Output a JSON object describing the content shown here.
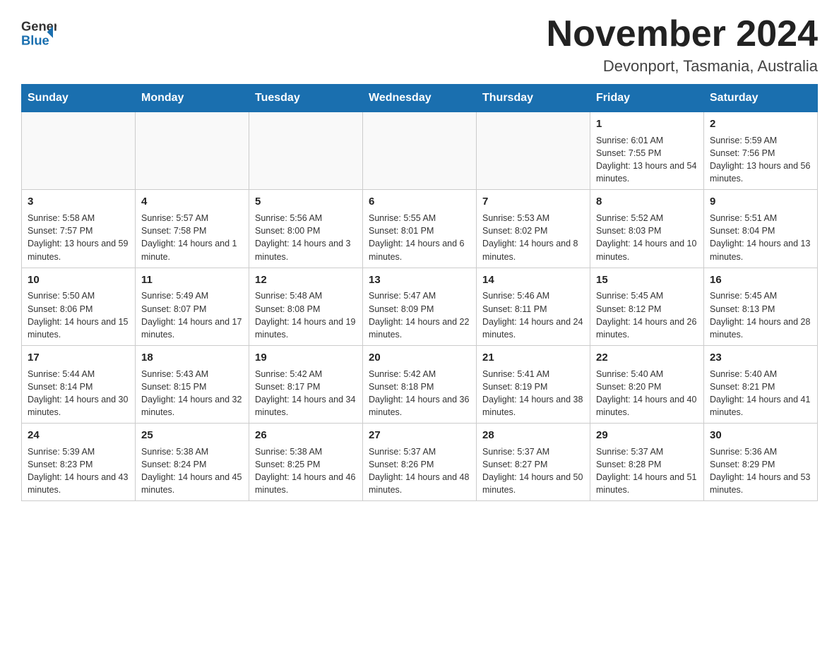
{
  "header": {
    "logo_general": "General",
    "logo_blue": "Blue",
    "month_title": "November 2024",
    "location": "Devonport, Tasmania, Australia"
  },
  "weekdays": [
    "Sunday",
    "Monday",
    "Tuesday",
    "Wednesday",
    "Thursday",
    "Friday",
    "Saturday"
  ],
  "weeks": [
    [
      {
        "day": "",
        "sunrise": "",
        "sunset": "",
        "daylight": ""
      },
      {
        "day": "",
        "sunrise": "",
        "sunset": "",
        "daylight": ""
      },
      {
        "day": "",
        "sunrise": "",
        "sunset": "",
        "daylight": ""
      },
      {
        "day": "",
        "sunrise": "",
        "sunset": "",
        "daylight": ""
      },
      {
        "day": "",
        "sunrise": "",
        "sunset": "",
        "daylight": ""
      },
      {
        "day": "1",
        "sunrise": "Sunrise: 6:01 AM",
        "sunset": "Sunset: 7:55 PM",
        "daylight": "Daylight: 13 hours and 54 minutes."
      },
      {
        "day": "2",
        "sunrise": "Sunrise: 5:59 AM",
        "sunset": "Sunset: 7:56 PM",
        "daylight": "Daylight: 13 hours and 56 minutes."
      }
    ],
    [
      {
        "day": "3",
        "sunrise": "Sunrise: 5:58 AM",
        "sunset": "Sunset: 7:57 PM",
        "daylight": "Daylight: 13 hours and 59 minutes."
      },
      {
        "day": "4",
        "sunrise": "Sunrise: 5:57 AM",
        "sunset": "Sunset: 7:58 PM",
        "daylight": "Daylight: 14 hours and 1 minute."
      },
      {
        "day": "5",
        "sunrise": "Sunrise: 5:56 AM",
        "sunset": "Sunset: 8:00 PM",
        "daylight": "Daylight: 14 hours and 3 minutes."
      },
      {
        "day": "6",
        "sunrise": "Sunrise: 5:55 AM",
        "sunset": "Sunset: 8:01 PM",
        "daylight": "Daylight: 14 hours and 6 minutes."
      },
      {
        "day": "7",
        "sunrise": "Sunrise: 5:53 AM",
        "sunset": "Sunset: 8:02 PM",
        "daylight": "Daylight: 14 hours and 8 minutes."
      },
      {
        "day": "8",
        "sunrise": "Sunrise: 5:52 AM",
        "sunset": "Sunset: 8:03 PM",
        "daylight": "Daylight: 14 hours and 10 minutes."
      },
      {
        "day": "9",
        "sunrise": "Sunrise: 5:51 AM",
        "sunset": "Sunset: 8:04 PM",
        "daylight": "Daylight: 14 hours and 13 minutes."
      }
    ],
    [
      {
        "day": "10",
        "sunrise": "Sunrise: 5:50 AM",
        "sunset": "Sunset: 8:06 PM",
        "daylight": "Daylight: 14 hours and 15 minutes."
      },
      {
        "day": "11",
        "sunrise": "Sunrise: 5:49 AM",
        "sunset": "Sunset: 8:07 PM",
        "daylight": "Daylight: 14 hours and 17 minutes."
      },
      {
        "day": "12",
        "sunrise": "Sunrise: 5:48 AM",
        "sunset": "Sunset: 8:08 PM",
        "daylight": "Daylight: 14 hours and 19 minutes."
      },
      {
        "day": "13",
        "sunrise": "Sunrise: 5:47 AM",
        "sunset": "Sunset: 8:09 PM",
        "daylight": "Daylight: 14 hours and 22 minutes."
      },
      {
        "day": "14",
        "sunrise": "Sunrise: 5:46 AM",
        "sunset": "Sunset: 8:11 PM",
        "daylight": "Daylight: 14 hours and 24 minutes."
      },
      {
        "day": "15",
        "sunrise": "Sunrise: 5:45 AM",
        "sunset": "Sunset: 8:12 PM",
        "daylight": "Daylight: 14 hours and 26 minutes."
      },
      {
        "day": "16",
        "sunrise": "Sunrise: 5:45 AM",
        "sunset": "Sunset: 8:13 PM",
        "daylight": "Daylight: 14 hours and 28 minutes."
      }
    ],
    [
      {
        "day": "17",
        "sunrise": "Sunrise: 5:44 AM",
        "sunset": "Sunset: 8:14 PM",
        "daylight": "Daylight: 14 hours and 30 minutes."
      },
      {
        "day": "18",
        "sunrise": "Sunrise: 5:43 AM",
        "sunset": "Sunset: 8:15 PM",
        "daylight": "Daylight: 14 hours and 32 minutes."
      },
      {
        "day": "19",
        "sunrise": "Sunrise: 5:42 AM",
        "sunset": "Sunset: 8:17 PM",
        "daylight": "Daylight: 14 hours and 34 minutes."
      },
      {
        "day": "20",
        "sunrise": "Sunrise: 5:42 AM",
        "sunset": "Sunset: 8:18 PM",
        "daylight": "Daylight: 14 hours and 36 minutes."
      },
      {
        "day": "21",
        "sunrise": "Sunrise: 5:41 AM",
        "sunset": "Sunset: 8:19 PM",
        "daylight": "Daylight: 14 hours and 38 minutes."
      },
      {
        "day": "22",
        "sunrise": "Sunrise: 5:40 AM",
        "sunset": "Sunset: 8:20 PM",
        "daylight": "Daylight: 14 hours and 40 minutes."
      },
      {
        "day": "23",
        "sunrise": "Sunrise: 5:40 AM",
        "sunset": "Sunset: 8:21 PM",
        "daylight": "Daylight: 14 hours and 41 minutes."
      }
    ],
    [
      {
        "day": "24",
        "sunrise": "Sunrise: 5:39 AM",
        "sunset": "Sunset: 8:23 PM",
        "daylight": "Daylight: 14 hours and 43 minutes."
      },
      {
        "day": "25",
        "sunrise": "Sunrise: 5:38 AM",
        "sunset": "Sunset: 8:24 PM",
        "daylight": "Daylight: 14 hours and 45 minutes."
      },
      {
        "day": "26",
        "sunrise": "Sunrise: 5:38 AM",
        "sunset": "Sunset: 8:25 PM",
        "daylight": "Daylight: 14 hours and 46 minutes."
      },
      {
        "day": "27",
        "sunrise": "Sunrise: 5:37 AM",
        "sunset": "Sunset: 8:26 PM",
        "daylight": "Daylight: 14 hours and 48 minutes."
      },
      {
        "day": "28",
        "sunrise": "Sunrise: 5:37 AM",
        "sunset": "Sunset: 8:27 PM",
        "daylight": "Daylight: 14 hours and 50 minutes."
      },
      {
        "day": "29",
        "sunrise": "Sunrise: 5:37 AM",
        "sunset": "Sunset: 8:28 PM",
        "daylight": "Daylight: 14 hours and 51 minutes."
      },
      {
        "day": "30",
        "sunrise": "Sunrise: 5:36 AM",
        "sunset": "Sunset: 8:29 PM",
        "daylight": "Daylight: 14 hours and 53 minutes."
      }
    ]
  ]
}
